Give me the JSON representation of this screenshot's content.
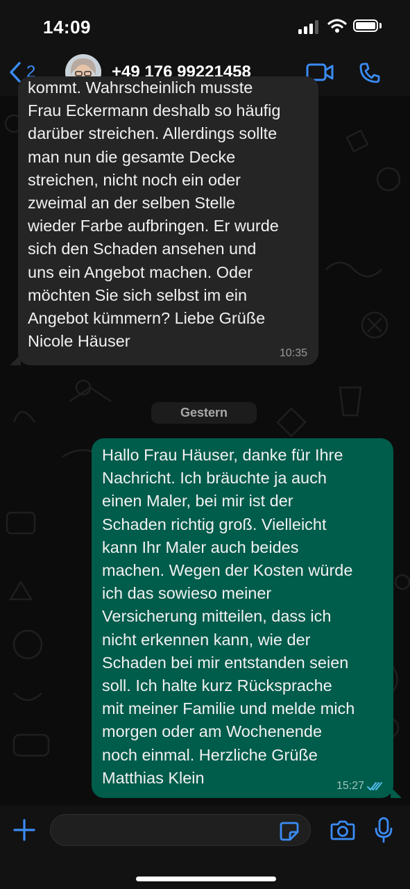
{
  "status_bar": {
    "time": "14:09"
  },
  "header": {
    "back_count": "2",
    "contact_name": "+49 176 99221458"
  },
  "messages": {
    "incoming": {
      "text": "kommt. Wahrscheinlich musste\nFrau Eckermann deshalb so häufig\ndarüber streichen. Allerdings sollte\nman nun die gesamte Decke\nstreichen, nicht noch ein oder\nzweimal an der selben Stelle\nwieder Farbe aufbringen. Er wurde\nsich den Schaden ansehen und\nuns ein Angebot machen. Oder\nmöchten Sie sich selbst im ein\nAngebot kümmern? Liebe Grüße\nNicole Häuser",
      "time": "10:35"
    },
    "date_separator": "Gestern",
    "outgoing": {
      "text": "Hallo Frau Häuser, danke für Ihre\nNachricht. Ich bräuchte ja auch\neinen Maler, bei mir ist der\nSchaden richtig groß. Vielleicht\nkann Ihr Maler auch beides\nmachen. Wegen der Kosten würde\nich das sowieso meiner\nVersicherung mitteilen, dass ich\nnicht erkennen kann, wie der\nSchaden bei mir entstanden seien\nsoll. Ich halte kurz Rücksprache\nmit meiner Familie und melde mich\nmorgen oder am Wochenende\nnoch einmal. Herzliche Grüße\nMatthias Klein",
      "time": "15:27",
      "status": "read"
    }
  },
  "colors": {
    "accent": "#3b8cf5",
    "outgoing_bubble": "#005c4b",
    "incoming_bubble": "#252525",
    "read_ticks": "#53bdeb"
  },
  "icons": {
    "back": "chevron-left-icon",
    "video": "video-camera-icon",
    "phone": "phone-icon",
    "plus": "plus-icon",
    "sticker": "sticker-icon",
    "camera": "camera-icon",
    "mic": "microphone-icon",
    "ticks": "double-check-icon"
  }
}
